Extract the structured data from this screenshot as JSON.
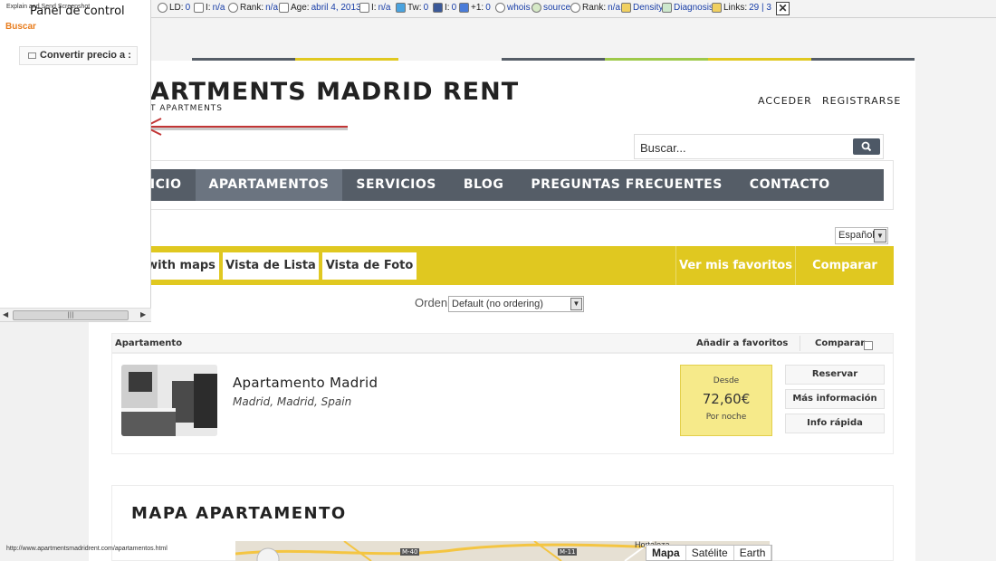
{
  "seo_toolbar": {
    "explain_label": "Explain and Send Screenshot",
    "items": [
      {
        "key": "LD:",
        "val": "0"
      },
      {
        "key": "I:",
        "val": "n/a"
      },
      {
        "key": "Rank:",
        "val": "n/a"
      },
      {
        "key": "Age:",
        "val": "abril 4, 2013"
      },
      {
        "key": "I:",
        "val": "n/a"
      },
      {
        "key": "Tw:",
        "val": "0"
      },
      {
        "key": "I:",
        "val": "0"
      },
      {
        "key": "+1:",
        "val": "0"
      },
      {
        "key": "",
        "val": "whois"
      },
      {
        "key": "",
        "val": "source"
      },
      {
        "key": "Rank:",
        "val": "n/a"
      },
      {
        "key": "",
        "val": "Density"
      },
      {
        "key": "",
        "val": "Diagnosis"
      },
      {
        "key": "Links:",
        "val": "29 | 3"
      }
    ]
  },
  "left_panel": {
    "title": "Panel de control",
    "search_label": "Buscar",
    "convert_button": "Convertir precio a :"
  },
  "header": {
    "logo": "ARTMENTS MADRID RENT",
    "tagline": "T APARTMENTS",
    "login": "ACCEDER",
    "register": "REGISTRARSE",
    "search_placeholder": "Buscar..."
  },
  "nav": {
    "items": [
      "INICIO",
      "APARTAMENTOS",
      "SERVICIOS",
      "BLOG",
      "PREGUNTAS FRECUENTES",
      "CONTACTO"
    ],
    "active_index": 1
  },
  "language": "Español",
  "view_bar": {
    "maps": "with maps",
    "list": "Vista de Lista",
    "photo": "Vista de Foto",
    "favorites": "Ver mis favoritos",
    "compare": "Comparar"
  },
  "ordering": {
    "label": "Orden",
    "selected": "Default (no ordering)"
  },
  "list_header": {
    "apartment": "Apartamento",
    "add_fav": "Añadir a favoritos",
    "compare": "Comparar"
  },
  "listing": {
    "name": "Apartamento Madrid",
    "location": "Madrid, Madrid, Spain",
    "price_from": "Desde",
    "price": "72,60€",
    "per_night": "Por noche",
    "actions": [
      "Reservar",
      "Más información",
      "Info rápida"
    ]
  },
  "map_section": {
    "title": "MAPA APARTAMENTO",
    "tabs": [
      "Mapa",
      "Satélite",
      "Earth"
    ],
    "place": "Hortaleza",
    "roads": [
      "M-40",
      "M-11"
    ]
  },
  "status_url": "http://www.apartmentsmadridrent.com/apartamentos.html",
  "colors": {
    "accent_yellow": "#e0c820",
    "nav_gray": "#555d67",
    "stripe_colors": [
      "#555d67",
      "#e0c820",
      "#555d67",
      "#9ec94a",
      "#e0c820",
      "#555d67"
    ]
  }
}
